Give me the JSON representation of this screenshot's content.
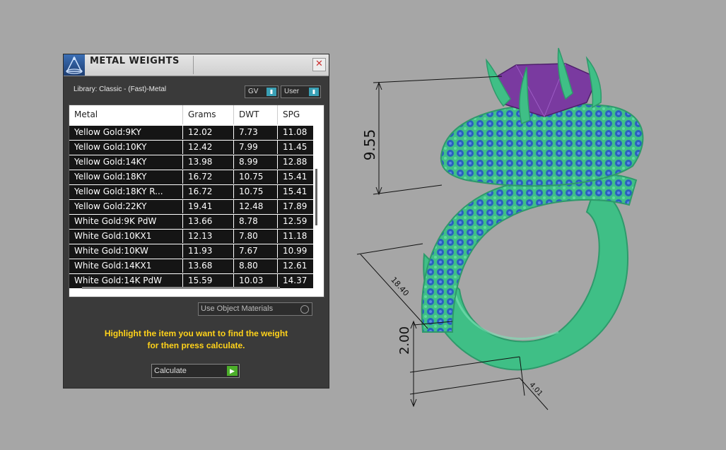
{
  "panel": {
    "title": "METAL WEIGHTS",
    "close_glyph": "✕",
    "library_label": "Library: Classic - (Fast)-Metal",
    "gv_label": "GV",
    "user_label": "User",
    "columns": [
      "Metal",
      "Grams",
      "DWT",
      "SPG"
    ],
    "rows": [
      [
        "Yellow Gold:9KY",
        "12.02",
        "7.73",
        "11.08"
      ],
      [
        "Yellow Gold:10KY",
        "12.42",
        "7.99",
        "11.45"
      ],
      [
        "Yellow Gold:14KY",
        "13.98",
        "8.99",
        "12.88"
      ],
      [
        "Yellow Gold:18KY",
        "16.72",
        "10.75",
        "15.41"
      ],
      [
        "Yellow Gold:18KY R...",
        "16.72",
        "10.75",
        "15.41"
      ],
      [
        "Yellow Gold:22KY",
        "19.41",
        "12.48",
        "17.89"
      ],
      [
        "White Gold:9K PdW",
        "13.66",
        "8.78",
        "12.59"
      ],
      [
        "White Gold:10KX1",
        "12.13",
        "7.80",
        "11.18"
      ],
      [
        "White Gold:10KW",
        "11.93",
        "7.67",
        "10.99"
      ],
      [
        "White Gold:14KX1",
        "13.68",
        "8.80",
        "12.61"
      ],
      [
        "White Gold:14K PdW",
        "15.59",
        "10.03",
        "14.37"
      ]
    ],
    "use_object_label": "Use Object Materials",
    "hint_line1": "Highlight the item you want to find the weight",
    "hint_line2": "for then press calculate.",
    "calculate_label": "Calculate"
  },
  "dimensions": {
    "height": "9.55",
    "width": "18.40",
    "shank": "2.00",
    "band": "4.01"
  },
  "colors": {
    "metal": "#3fbf86",
    "stones": "#2a5fc0",
    "gem": "#7a3aa0",
    "highlight_text": "#ffd21a"
  }
}
